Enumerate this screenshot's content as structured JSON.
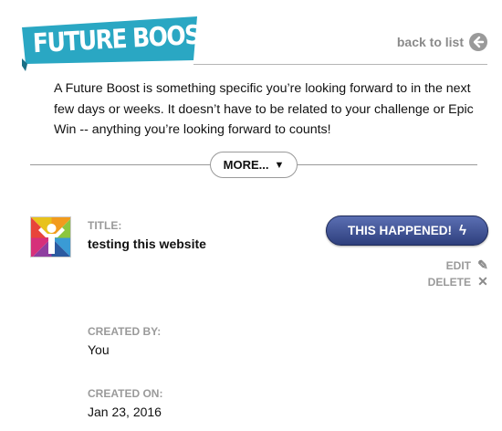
{
  "header": {
    "banner_title": "FUTURE BOOSTS",
    "back_label": "back to list",
    "banner_color": "#2aa7c3"
  },
  "intro": {
    "text": "A Future Boost is something specific you’re looking forward to in the next few days or weeks. It doesn’t have to be related to your challenge or Epic Win -- anything you’re looking forward to counts!"
  },
  "more": {
    "label": "MORE...",
    "icon": "triangle-down-icon"
  },
  "item": {
    "title_label": "TITLE:",
    "title": "testing this website",
    "happened_label": "THIS HAPPENED!",
    "happened_color": "#34468a",
    "edit_label": "EDIT",
    "delete_label": "DELETE",
    "created_by_label": "CREATED BY:",
    "created_by": "You",
    "created_on_label": "CREATED ON:",
    "created_on": "Jan 23, 2016"
  }
}
